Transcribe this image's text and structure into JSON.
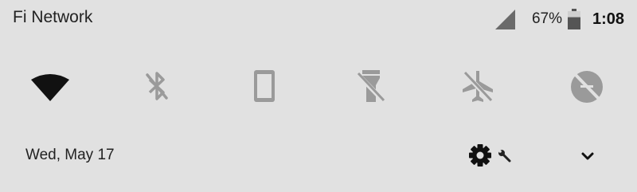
{
  "status_bar": {
    "carrier": "Fi Network",
    "battery_percent": "67%",
    "battery_level": 0.67,
    "time": "1:08",
    "icons": [
      "signal-icon",
      "battery-icon"
    ]
  },
  "quick_settings": {
    "tiles": [
      {
        "name": "wifi",
        "icon": "wifi-icon",
        "active": true
      },
      {
        "name": "bluetooth",
        "icon": "bluetooth-off-icon",
        "active": false
      },
      {
        "name": "rotation",
        "icon": "phone-portrait-icon",
        "active": false
      },
      {
        "name": "flashlight",
        "icon": "flashlight-off-icon",
        "active": false
      },
      {
        "name": "airplane-mode",
        "icon": "airplane-off-icon",
        "active": false
      },
      {
        "name": "data-saver",
        "icon": "data-saver-off-icon",
        "active": false
      }
    ]
  },
  "footer": {
    "date": "Wed, May 17",
    "settings_icon": "gear-icon",
    "developer_icon": "wrench-icon",
    "expand_icon": "chevron-down-icon"
  },
  "colors": {
    "background": "#e1e1e1",
    "active_icon": "#111111",
    "inactive_icon": "#9a9a9a",
    "text": "#222222"
  }
}
